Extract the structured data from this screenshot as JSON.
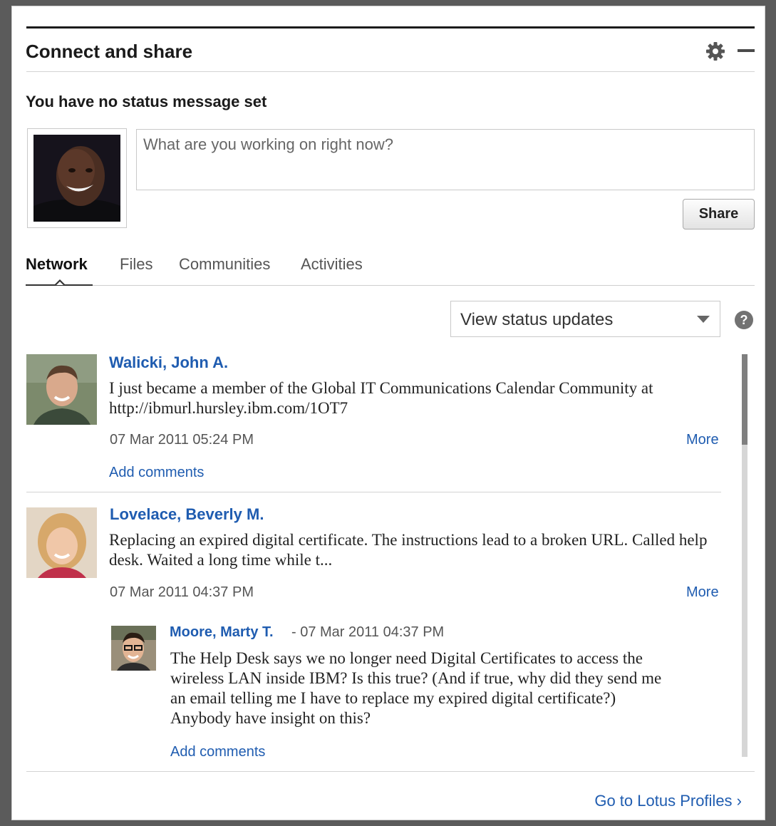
{
  "widget": {
    "title": "Connect and share",
    "settings_icon": "gear-icon",
    "minimize_icon": "minus-icon"
  },
  "status": {
    "message": "You have no status message set",
    "input_placeholder": "What are you working on right now?",
    "share_label": "Share"
  },
  "tabs": [
    {
      "label": "Network",
      "active": true
    },
    {
      "label": "Files",
      "active": false
    },
    {
      "label": "Communities",
      "active": false
    },
    {
      "label": "Activities",
      "active": false
    }
  ],
  "filter": {
    "selected": "View status updates",
    "help_icon": "question-icon"
  },
  "updates": [
    {
      "name": "Walicki, John A.",
      "message": "I just became a member of the Global IT Communications Calendar Community at http://ibmurl.hursley.ibm.com/1OT7",
      "date": "07 Mar 2011 05:24 PM",
      "more": "More",
      "add_comments": "Add comments"
    },
    {
      "name": "Lovelace, Beverly M.",
      "message": "Replacing an expired digital certificate. The instructions lead to a broken URL. Called help desk. Waited a long time while t...",
      "date": "07 Mar 2011 04:37 PM",
      "more": "More",
      "comment": {
        "name": "Moore, Marty T.",
        "date": "- 07 Mar 2011 04:37 PM",
        "message": "The Help Desk says we no longer need Digital Certificates to access the wireless LAN inside IBM? Is this true? (And if true, why did they send me an email telling me I have to replace my expired digital certificate?) Anybody have insight on this?",
        "add_comments": "Add comments"
      }
    }
  ],
  "footer": {
    "link": "Go to Lotus Profiles ›"
  },
  "colors": {
    "link": "#1f5cb0",
    "title_bar": "#1b1b1b"
  }
}
